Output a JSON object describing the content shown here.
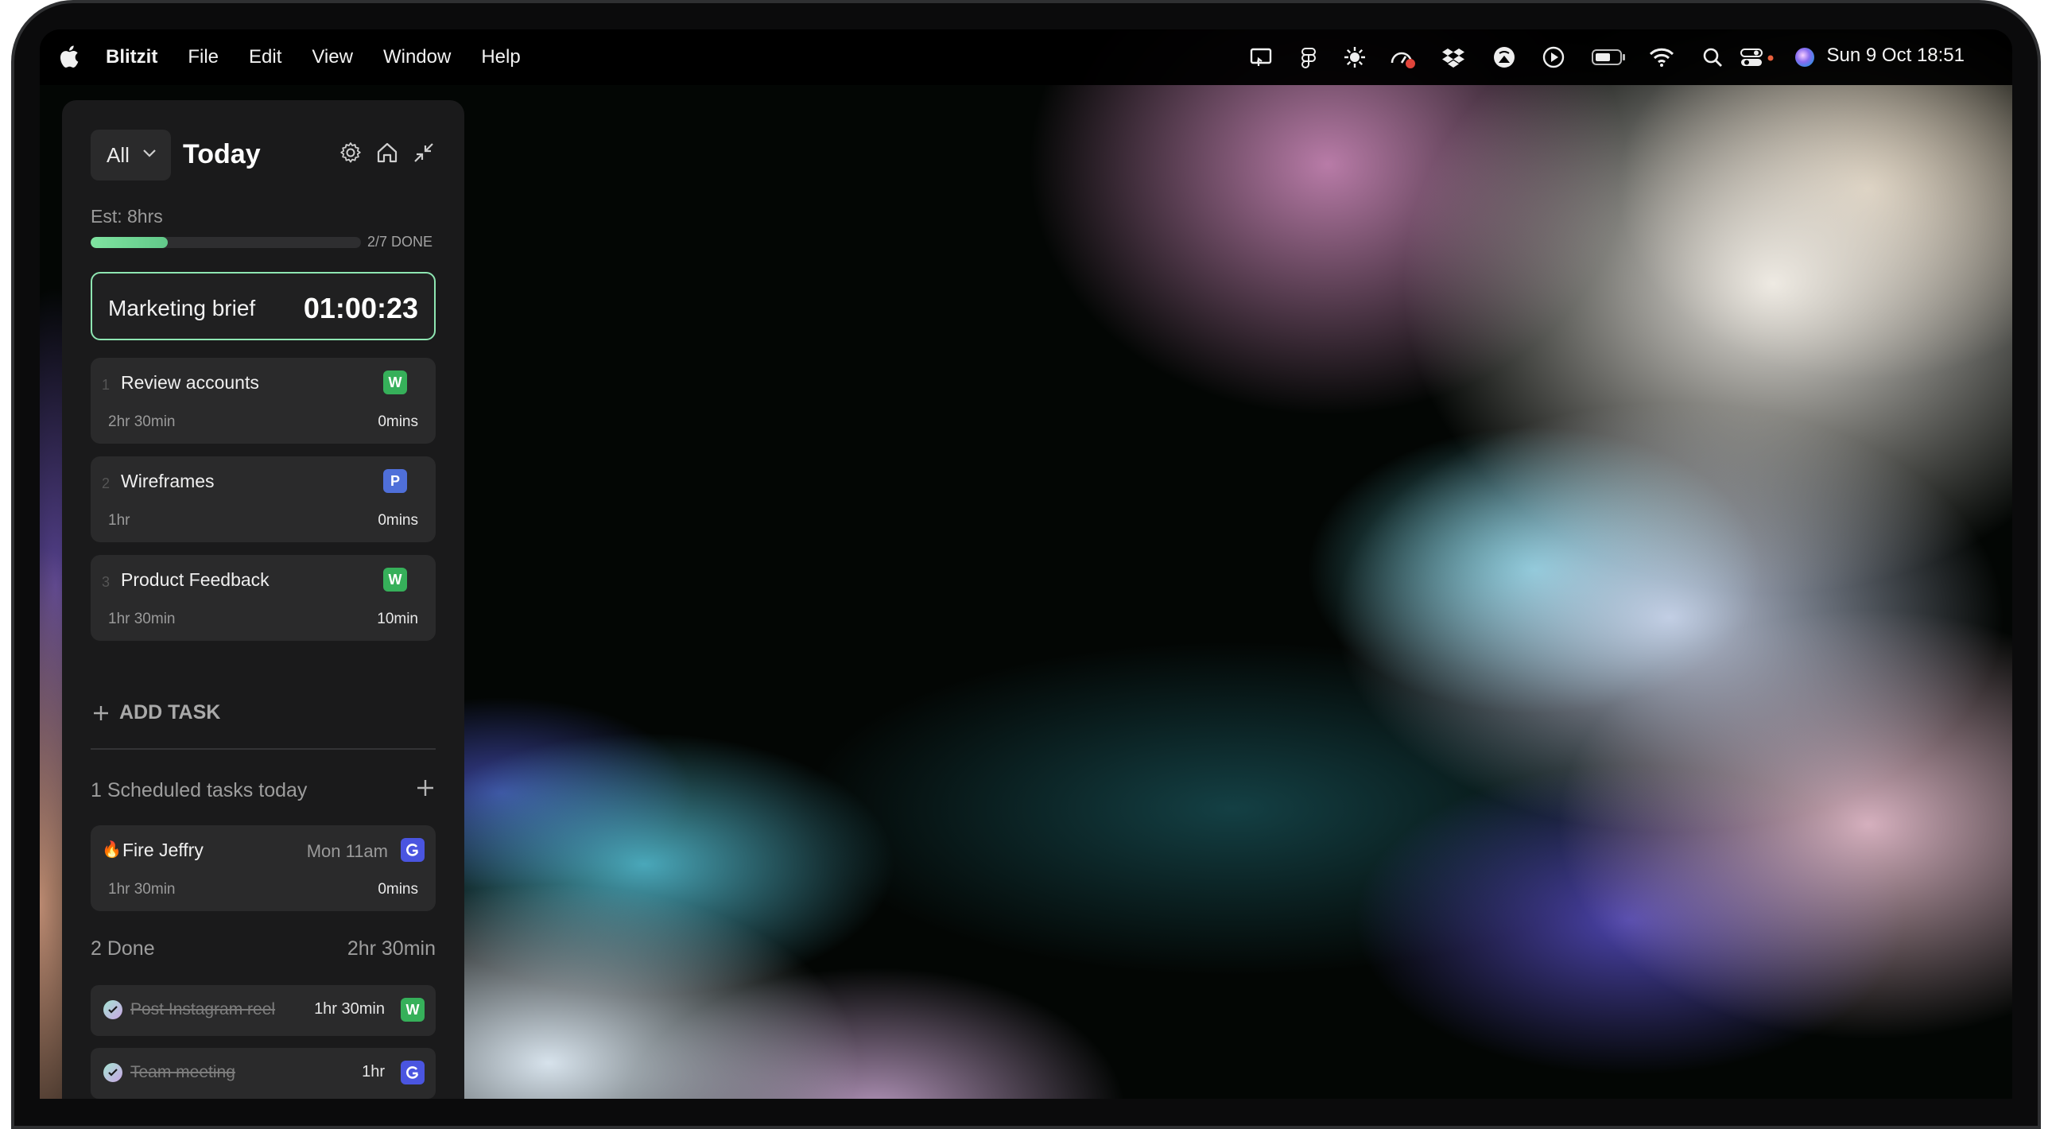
{
  "menubar": {
    "app_name": "Blitzit",
    "menus": [
      "File",
      "Edit",
      "View",
      "Window",
      "Help"
    ],
    "clock": "Sun 9 Oct  18:51",
    "tray_icons": [
      "screen-share-icon",
      "figma-icon",
      "sun-icon",
      "activity-icon",
      "dropbox-icon",
      "airplay-icon",
      "play-icon",
      "battery-icon",
      "wifi-icon",
      "search-icon",
      "control-center-icon",
      "siri-icon"
    ]
  },
  "panel": {
    "filter_label": "All",
    "title": "Today",
    "estimate": "Est: 8hrs",
    "progress_fraction": 0.2857,
    "progress_text": "2/7 DONE",
    "current_task": {
      "name": "Marketing brief",
      "timer": "01:00:23"
    },
    "tasks": [
      {
        "number": "1",
        "name": "Review accounts",
        "badge": "W",
        "estimate": "2hr 30min",
        "spent": "0mins",
        "badge_color": "#36b05a"
      },
      {
        "number": "2",
        "name": "Wireframes",
        "badge": "P",
        "estimate": "1hr",
        "spent": "0mins",
        "badge_color": "#4f6fd9"
      },
      {
        "number": "3",
        "name": "Product Feedback",
        "badge": "W",
        "estimate": "1hr 30min",
        "spent": "10min",
        "badge_color": "#36b05a"
      }
    ],
    "add_task_label": "ADD TASK",
    "scheduled": {
      "heading": "1 Scheduled tasks today",
      "items": [
        {
          "emoji": "🔥",
          "name": "Fire Jeffry",
          "when": "Mon 11am",
          "estimate": "1hr 30min",
          "spent": "0mins",
          "badge_icon": "google-calendar-icon"
        }
      ]
    },
    "done": {
      "heading": "2 Done",
      "total": "2hr 30min",
      "items": [
        {
          "name": "Post Instagram reel",
          "time": "1hr 30min",
          "badge": "W"
        },
        {
          "name": "Team meeting",
          "time": "1hr",
          "badge_icon": "google-calendar-icon"
        }
      ]
    },
    "accent_color": "#8ee6b2"
  }
}
